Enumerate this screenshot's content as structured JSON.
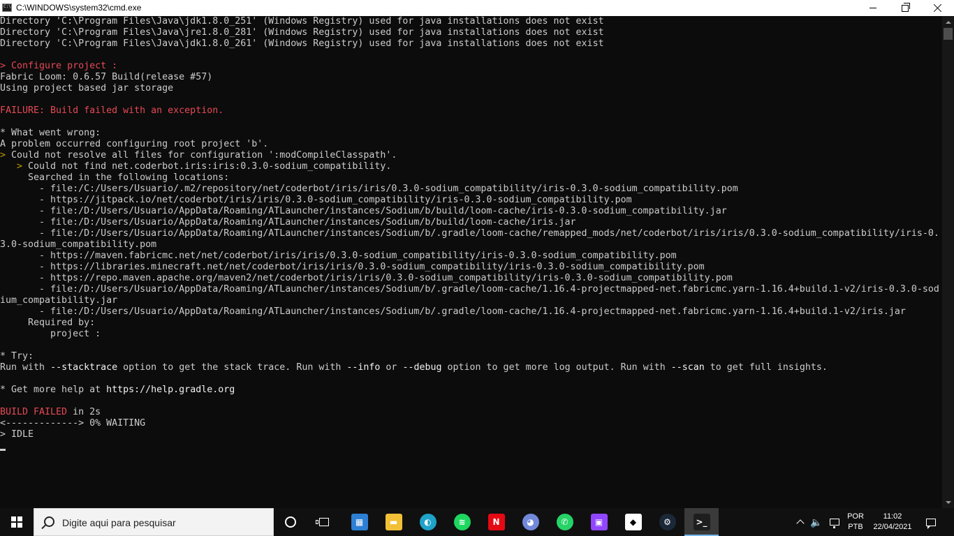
{
  "window": {
    "title": "C:\\WINDOWS\\system32\\cmd.exe",
    "controls": [
      "minimize-icon",
      "maximize-icon",
      "close-icon"
    ]
  },
  "console": {
    "lines": [
      [
        {
          "t": "Directory 'C:\\Program Files\\Java\\jdk1.8.0_251' (Windows Registry) used for java installations does not exist"
        }
      ],
      [
        {
          "t": "Directory 'C:\\Program Files\\Java\\jre1.8.0_281' (Windows Registry) used for java installations does not exist"
        }
      ],
      [
        {
          "t": "Directory 'C:\\Program Files\\Java\\jdk1.8.0_261' (Windows Registry) used for java installations does not exist"
        }
      ],
      [],
      [
        {
          "t": "> Configure project :",
          "c": "red"
        }
      ],
      [
        {
          "t": "Fabric Loom: 0.6.57 Build(release #57)"
        }
      ],
      [
        {
          "t": "Using project based jar storage"
        }
      ],
      [],
      [
        {
          "t": "FAILURE: Build failed with an exception.",
          "c": "red"
        }
      ],
      [],
      [
        {
          "t": "* What went wrong:"
        }
      ],
      [
        {
          "t": "A problem occurred configuring root project 'b'."
        }
      ],
      [
        {
          "t": "> ",
          "c": "yellow"
        },
        {
          "t": "Could not resolve all files for configuration ':modCompileClasspath'."
        }
      ],
      [
        {
          "t": "   > ",
          "c": "yellow"
        },
        {
          "t": "Could not find net.coderbot.iris:iris:0.3.0-sodium_compatibility."
        }
      ],
      [
        {
          "t": "     Searched in the following locations:"
        }
      ],
      [
        {
          "t": "       - file:/C:/Users/Usuario/.m2/repository/net/coderbot/iris/iris/0.3.0-sodium_compatibility/iris-0.3.0-sodium_compatibility.pom"
        }
      ],
      [
        {
          "t": "       - https://jitpack.io/net/coderbot/iris/iris/0.3.0-sodium_compatibility/iris-0.3.0-sodium_compatibility.pom"
        }
      ],
      [
        {
          "t": "       - file:/D:/Users/Usuario/AppData/Roaming/ATLauncher/instances/Sodium/b/build/loom-cache/iris-0.3.0-sodium_compatibility.jar"
        }
      ],
      [
        {
          "t": "       - file:/D:/Users/Usuario/AppData/Roaming/ATLauncher/instances/Sodium/b/build/loom-cache/iris.jar"
        }
      ],
      [
        {
          "t": "       - file:/D:/Users/Usuario/AppData/Roaming/ATLauncher/instances/Sodium/b/.gradle/loom-cache/remapped_mods/net/coderbot/iris/iris/0.3.0-sodium_compatibility/iris-0."
        }
      ],
      [
        {
          "t": "3.0-sodium_compatibility.pom"
        }
      ],
      [
        {
          "t": "       - https://maven.fabricmc.net/net/coderbot/iris/iris/0.3.0-sodium_compatibility/iris-0.3.0-sodium_compatibility.pom"
        }
      ],
      [
        {
          "t": "       - https://libraries.minecraft.net/net/coderbot/iris/iris/0.3.0-sodium_compatibility/iris-0.3.0-sodium_compatibility.pom"
        }
      ],
      [
        {
          "t": "       - https://repo.maven.apache.org/maven2/net/coderbot/iris/iris/0.3.0-sodium_compatibility/iris-0.3.0-sodium_compatibility.pom"
        }
      ],
      [
        {
          "t": "       - file:/D:/Users/Usuario/AppData/Roaming/ATLauncher/instances/Sodium/b/.gradle/loom-cache/1.16.4-projectmapped-net.fabricmc.yarn-1.16.4+build.1-v2/iris-0.3.0-sod"
        }
      ],
      [
        {
          "t": "ium_compatibility.jar"
        }
      ],
      [
        {
          "t": "       - file:/D:/Users/Usuario/AppData/Roaming/ATLauncher/instances/Sodium/b/.gradle/loom-cache/1.16.4-projectmapped-net.fabricmc.yarn-1.16.4+build.1-v2/iris.jar"
        }
      ],
      [
        {
          "t": "     Required by:"
        }
      ],
      [
        {
          "t": "         project :"
        }
      ],
      [],
      [
        {
          "t": "* Try:"
        }
      ],
      [
        {
          "t": "Run with "
        },
        {
          "t": "--stacktrace",
          "c": "bold"
        },
        {
          "t": " option to get the stack trace. Run with "
        },
        {
          "t": "--info",
          "c": "bold"
        },
        {
          "t": " or "
        },
        {
          "t": "--debug",
          "c": "bold"
        },
        {
          "t": " option to get more log output. Run with "
        },
        {
          "t": "--scan",
          "c": "bold"
        },
        {
          "t": " to get full insights."
        }
      ],
      [],
      [
        {
          "t": "* Get more help at "
        },
        {
          "t": "https://help.gradle.org",
          "c": "bold"
        }
      ],
      [],
      [
        {
          "t": "BUILD FAILED",
          "c": "red"
        },
        {
          "t": " in 2s"
        }
      ],
      [
        {
          "t": "<-------------> 0% WAITING"
        }
      ],
      [
        {
          "t": "> IDLE"
        }
      ]
    ]
  },
  "taskbar": {
    "search_placeholder": "Digite aqui para pesquisar",
    "apps": [
      {
        "name": "microsoft-store-icon",
        "color": "#2d7fd3",
        "glyph": "▦"
      },
      {
        "name": "file-explorer-icon",
        "color": "#f2c037",
        "glyph": "▬"
      },
      {
        "name": "edge-icon",
        "color": "#1fa3c9",
        "glyph": "◐"
      },
      {
        "name": "spotify-icon",
        "color": "#1ed760",
        "glyph": "≋"
      },
      {
        "name": "netflix-icon",
        "color": "#e50914",
        "glyph": "N"
      },
      {
        "name": "discord-icon",
        "color": "#7289da",
        "glyph": "◕"
      },
      {
        "name": "whatsapp-icon",
        "color": "#25d366",
        "glyph": "✆"
      },
      {
        "name": "twitch-icon",
        "color": "#9146ff",
        "glyph": "▣"
      },
      {
        "name": "game-launcher-icon",
        "color": "#ffffff",
        "glyph": "◆"
      },
      {
        "name": "steam-icon",
        "color": "#1b2838",
        "glyph": "⚙"
      },
      {
        "name": "command-prompt-icon",
        "color": "#1e1e1e",
        "glyph": ">_",
        "active": true
      }
    ],
    "language": {
      "line1": "POR",
      "line2": "PTB"
    },
    "clock": {
      "time": "11:02",
      "date": "22/04/2021"
    }
  }
}
